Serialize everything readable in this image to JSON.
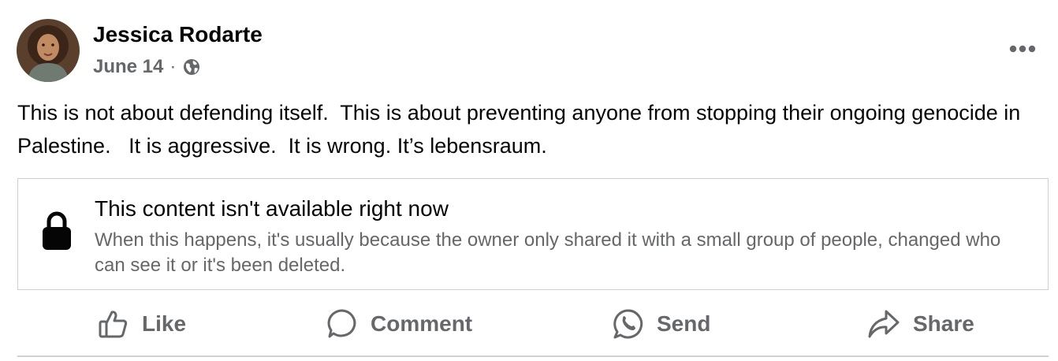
{
  "post": {
    "author": "Jessica Rodarte",
    "date": "June 14",
    "separator": "·",
    "privacy_icon": "globe-icon",
    "text": "This is not about defending itself.  This is about preventing anyone from stopping their ongoing genocide in Palestine.   It is aggressive.  It is wrong. It’s lebensraum."
  },
  "unavailable": {
    "icon": "lock-icon",
    "title": "This content isn't available right now",
    "description": "When this happens, it's usually because the owner only shared it with a small group of people, changed who can see it or it's been deleted."
  },
  "actions": {
    "like": "Like",
    "comment": "Comment",
    "send": "Send",
    "share": "Share"
  },
  "colors": {
    "primary_text": "#050505",
    "secondary_text": "#65676b",
    "divider": "#ced0d4"
  }
}
